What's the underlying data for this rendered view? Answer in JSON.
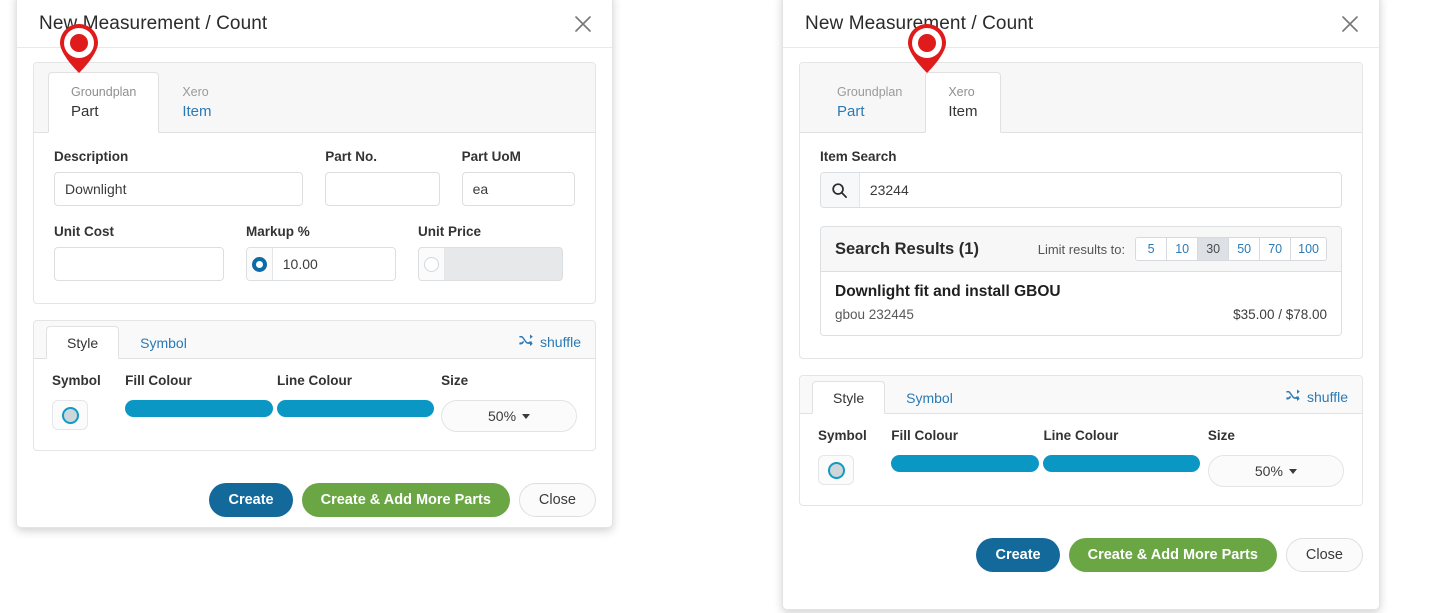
{
  "dialogs": [
    {
      "id": "left",
      "title": "New Measurement / Count",
      "close_icon": "close-icon",
      "tabs": [
        {
          "sup": "Groundplan",
          "main": "Part",
          "active": true
        },
        {
          "sup": "Xero",
          "main": "Item",
          "active": false
        }
      ],
      "form": {
        "description": {
          "label": "Description",
          "value": "Downlight",
          "placeholder": ""
        },
        "part_no": {
          "label": "Part No.",
          "value": "",
          "placeholder": ""
        },
        "part_uom": {
          "label": "Part UoM",
          "value": "ea",
          "placeholder": ""
        },
        "unit_cost": {
          "label": "Unit Cost",
          "value": "",
          "placeholder": ""
        },
        "markup": {
          "label": "Markup %",
          "value": "10.00",
          "placeholder": "",
          "selected": true
        },
        "unit_price": {
          "label": "Unit Price",
          "value": "",
          "placeholder": "",
          "selected": false
        }
      },
      "style": {
        "tabs": [
          {
            "label": "Style",
            "active": true
          },
          {
            "label": "Symbol",
            "active": false
          }
        ],
        "shuffle_label": "shuffle",
        "shuffle_icon": "shuffle-icon",
        "symbol_label": "Symbol",
        "symbol_icon": "circle-ring-icon",
        "fill_label": "Fill Colour",
        "fill_colour": "#0b97c4",
        "line_label": "Line Colour",
        "line_colour": "#0b97c4",
        "size_label": "Size",
        "size_value": "50%"
      },
      "footer": {
        "create": "Create",
        "create_add": "Create & Add More Parts",
        "close": "Close"
      }
    },
    {
      "id": "right",
      "title": "New Measurement / Count",
      "close_icon": "close-icon",
      "tabs": [
        {
          "sup": "Groundplan",
          "main": "Part",
          "active": false
        },
        {
          "sup": "Xero",
          "main": "Item",
          "active": true
        }
      ],
      "search": {
        "label": "Item Search",
        "icon": "search-icon",
        "value": "23244",
        "placeholder": ""
      },
      "results": {
        "title": "Search Results (1)",
        "limit_label": "Limit results to:",
        "limit_options": [
          "5",
          "10",
          "30",
          "50",
          "70",
          "100"
        ],
        "limit_selected": "30",
        "rows": [
          {
            "name": "Downlight fit and install GBOU",
            "code": "gbou 232445",
            "price": "$35.00 / $78.00"
          }
        ]
      },
      "style": {
        "tabs": [
          {
            "label": "Style",
            "active": true
          },
          {
            "label": "Symbol",
            "active": false
          }
        ],
        "shuffle_label": "shuffle",
        "shuffle_icon": "shuffle-icon",
        "symbol_label": "Symbol",
        "symbol_icon": "circle-ring-icon",
        "fill_label": "Fill Colour",
        "fill_colour": "#0b97c4",
        "line_label": "Line Colour",
        "line_colour": "#0b97c4",
        "size_label": "Size",
        "size_value": "50%"
      },
      "footer": {
        "create": "Create",
        "create_add": "Create & Add More Parts",
        "close": "Close"
      }
    }
  ],
  "markers": [
    {
      "name": "map-pin-marker-left",
      "colour": "#e01b1b"
    },
    {
      "name": "map-pin-marker-right",
      "colour": "#e01b1b"
    }
  ]
}
